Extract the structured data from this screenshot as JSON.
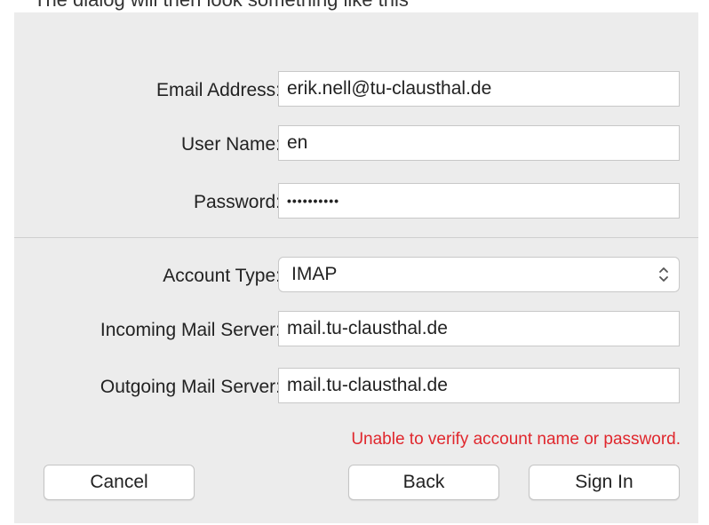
{
  "caption": "The dialog will then look something like this",
  "form": {
    "email_label": "Email Address:",
    "email_value": "erik.nell@tu-clausthal.de",
    "username_label": "User Name:",
    "username_value": "en",
    "password_label": "Password:",
    "password_value": "••••••••••",
    "account_type_label": "Account Type:",
    "account_type_value": "IMAP",
    "incoming_label": "Incoming Mail Server:",
    "incoming_value": "mail.tu-clausthal.de",
    "outgoing_label": "Outgoing Mail Server:",
    "outgoing_value": "mail.tu-clausthal.de"
  },
  "error_message": "Unable to verify account name or password.",
  "buttons": {
    "cancel": "Cancel",
    "back": "Back",
    "sign_in": "Sign In"
  },
  "colors": {
    "error": "#e0272d",
    "dialog_background": "#ececec"
  },
  "icons": {
    "select_arrows": "chevron-up-down-icon"
  }
}
